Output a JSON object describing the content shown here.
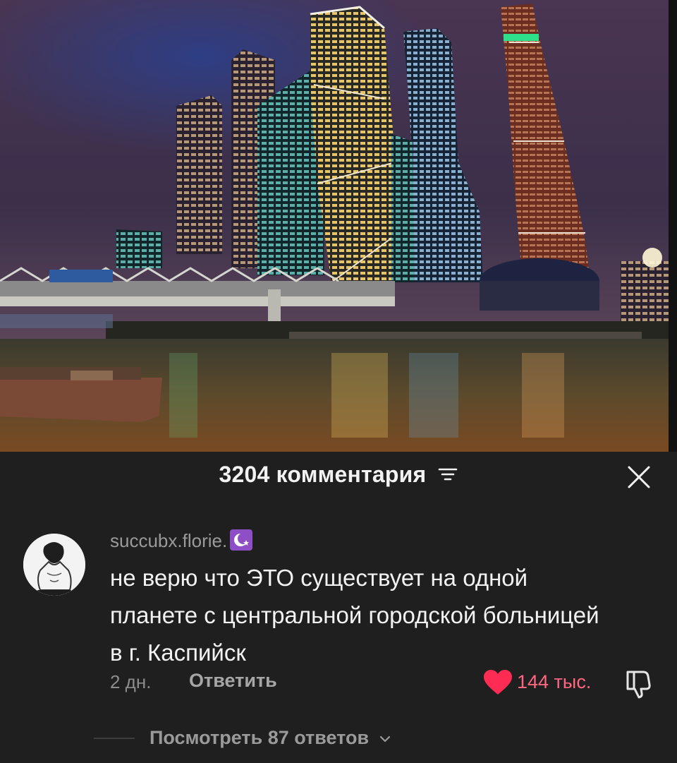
{
  "post": {
    "image_description_name": "moscow-city-night-photo"
  },
  "comments_panel": {
    "title": "3204 комментария",
    "icons": {
      "sort": "sort-lines-icon",
      "close": "close-x-icon"
    }
  },
  "comment": {
    "username": "succubx.florie.",
    "badge_icon": "crescent-star-icon",
    "text": "не верю что ЭТО существует на одной планете с центральной городской больницей в г. Каспийск",
    "time": "2 дн.",
    "reply_label": "Ответить",
    "likes": "144 тыс.",
    "liked": true,
    "like_color": "#fe2c55",
    "view_replies_label": "Посмотреть 87 ответов"
  }
}
